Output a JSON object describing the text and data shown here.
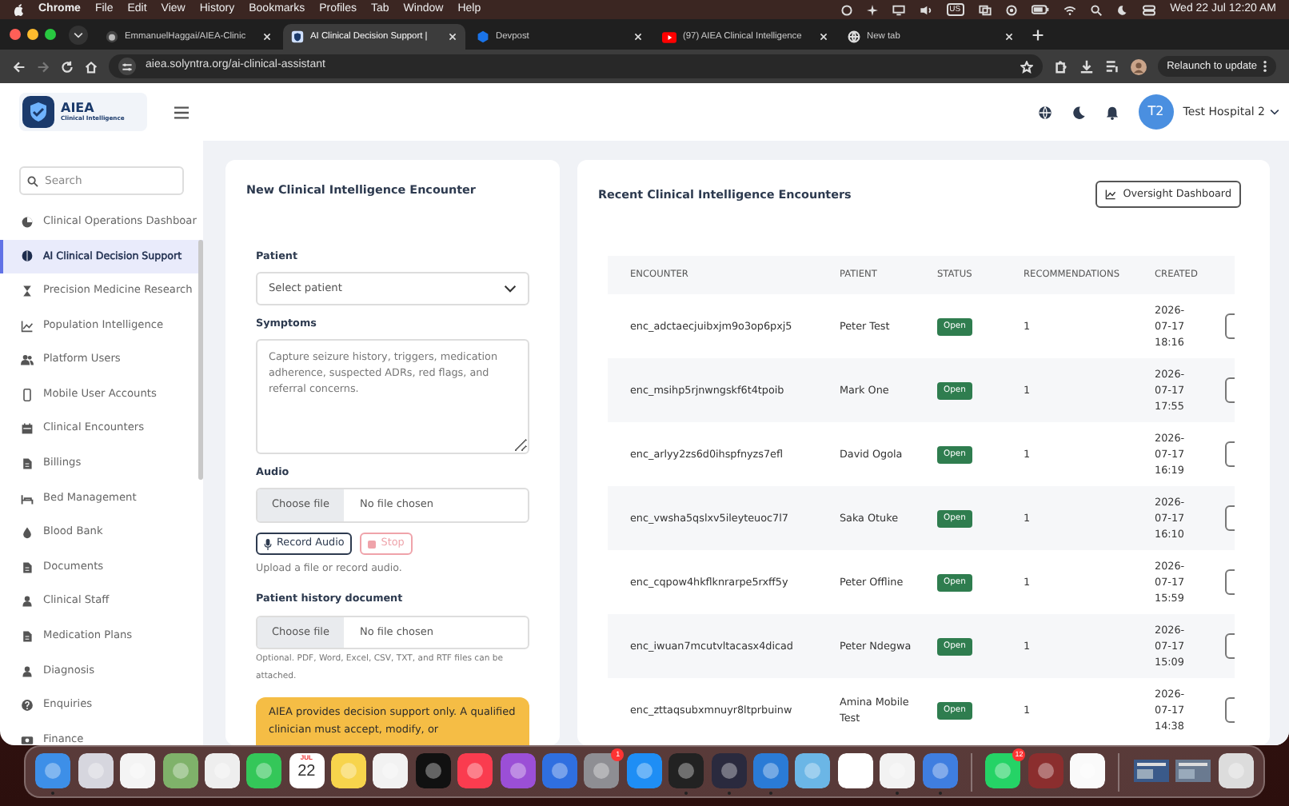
{
  "menubar": {
    "app": "Chrome",
    "menus": [
      "File",
      "Edit",
      "View",
      "History",
      "Bookmarks",
      "Profiles",
      "Tab",
      "Window",
      "Help"
    ],
    "input_source": "US",
    "clock": "Wed 22 Jul  12:20 AM"
  },
  "browser": {
    "tabs": [
      {
        "title": "EmmanuelHaggai/AIEA-Clinic",
        "kind": "github",
        "selected": false
      },
      {
        "title": "AI Clinical Decision Support |",
        "kind": "app",
        "selected": true
      },
      {
        "title": "Devpost",
        "kind": "devpost",
        "selected": false
      },
      {
        "title": "(97) AIEA Clinical Intelligence",
        "kind": "video",
        "selected": false
      },
      {
        "title": "New tab",
        "kind": "chrome",
        "selected": false
      }
    ],
    "url": "aiea.solyntra.org/ai-clinical-assistant",
    "forward_disabled": true,
    "update_button": "Relaunch to update"
  },
  "app": {
    "brand": "AIEA",
    "brand_sub": "Clinical Intelligence",
    "avatar": "T2",
    "hospital": "Test Hospital 2"
  },
  "sidebar": {
    "search_placeholder": "Search",
    "items": [
      {
        "label": "Clinical Operations Dashboar",
        "kind": "pie",
        "selected": false
      },
      {
        "label": "AI Clinical Decision Support",
        "kind": "dot",
        "selected": true
      },
      {
        "label": "Precision Medicine Research",
        "kind": "hourglass",
        "selected": false
      },
      {
        "label": "Population Intelligence",
        "kind": "linechart",
        "selected": false
      },
      {
        "label": "Platform Users",
        "kind": "users",
        "selected": false
      },
      {
        "label": "Mobile User Accounts",
        "kind": "phone",
        "selected": false
      },
      {
        "label": "Clinical Encounters",
        "kind": "calendar",
        "selected": false
      },
      {
        "label": "Billings",
        "kind": "document",
        "selected": false
      },
      {
        "label": "Bed Management",
        "kind": "bed",
        "selected": false
      },
      {
        "label": "Blood Bank",
        "kind": "drop",
        "selected": false
      },
      {
        "label": "Documents",
        "kind": "document",
        "selected": false
      },
      {
        "label": "Clinical Staff",
        "kind": "person",
        "selected": false
      },
      {
        "label": "Medication Plans",
        "kind": "document",
        "selected": false
      },
      {
        "label": "Diagnosis",
        "kind": "person",
        "selected": false
      },
      {
        "label": "Enquiries",
        "kind": "question",
        "selected": false
      },
      {
        "label": "Finance",
        "kind": "money",
        "selected": false
      }
    ]
  },
  "form": {
    "title": "New Clinical Intelligence Encounter",
    "patient_label": "Patient",
    "patient_placeholder": "Select patient",
    "symptoms_label": "Symptoms",
    "symptoms_placeholder": "Capture seizure history, triggers, medication adherence, suspected ADRs, red flags, and referral concerns.",
    "audio_label": "Audio",
    "audio_choose": "Choose file",
    "audio_status": "No file chosen",
    "record_button": "Record Audio",
    "stop_button": "Stop",
    "stop_disabled": true,
    "audio_hint": "Upload a file or record audio.",
    "history_label": "Patient history document",
    "history_choose": "Choose file",
    "history_status": "No file chosen",
    "history_hint": "Optional. PDF, Word, Excel, CSV, TXT, and RTF files can be attached.",
    "notice": "AIEA provides decision support only. A qualified clinician must accept, modify, or"
  },
  "encounters": {
    "title": "Recent Clinical Intelligence Encounters",
    "dashboard_button": "Oversight Dashboard",
    "columns": [
      "ENCOUNTER",
      "PATIENT",
      "STATUS",
      "RECOMMENDATIONS",
      "CREATED"
    ],
    "rows": [
      {
        "encounter": "enc_adctaecjuibxjm9o3op6pxj5",
        "patient": "Peter Test",
        "status": "Open",
        "recommendations": "1",
        "created": "2026-07-17 18:16"
      },
      {
        "encounter": "enc_msihp5rjnwngskf6t4tpoib",
        "patient": "Mark One",
        "status": "Open",
        "recommendations": "1",
        "created": "2026-07-17 17:55"
      },
      {
        "encounter": "enc_arlyy2zs6d0ihspfnyzs7efl",
        "patient": "David Ogola",
        "status": "Open",
        "recommendations": "1",
        "created": "2026-07-17 16:19"
      },
      {
        "encounter": "enc_vwsha5qslxv5ileyteuoc7l7",
        "patient": "Saka Otuke",
        "status": "Open",
        "recommendations": "1",
        "created": "2026-07-17 16:10"
      },
      {
        "encounter": "enc_cqpow4hkflknrarpe5rxff5y",
        "patient": "Peter Offline",
        "status": "Open",
        "recommendations": "1",
        "created": "2026-07-17 15:59"
      },
      {
        "encounter": "enc_iwuan7mcutvltacasx4dicad",
        "patient": "Peter Ndegwa",
        "status": "Open",
        "recommendations": "1",
        "created": "2026-07-17 15:09"
      },
      {
        "encounter": "enc_zttaqsubxmnuyr8ltprbuinw",
        "patient": "Amina Mobile Test",
        "status": "Open",
        "recommendations": "1",
        "created": "2026-07-17 14:38"
      }
    ]
  },
  "dock": [
    {
      "kind": "app",
      "color": "#3d8fe8",
      "running": true
    },
    {
      "kind": "app",
      "color": "#d6d6de",
      "running": false
    },
    {
      "kind": "app",
      "color": "#f4f4f4",
      "running": false
    },
    {
      "kind": "app",
      "color": "#7fb26a",
      "running": false
    },
    {
      "kind": "app",
      "color": "#eeeeee",
      "running": false
    },
    {
      "kind": "app",
      "color": "#34c759",
      "running": false
    },
    {
      "kind": "calendar",
      "month": "JUL",
      "day": "22",
      "running": false
    },
    {
      "kind": "app",
      "color": "#f7d44c",
      "running": false
    },
    {
      "kind": "app",
      "color": "#f2f2f2",
      "running": false
    },
    {
      "kind": "app",
      "color": "#111111",
      "running": false
    },
    {
      "kind": "app",
      "color": "#fa3c4f",
      "running": false
    },
    {
      "kind": "app",
      "color": "#9b4fd6",
      "running": false
    },
    {
      "kind": "app",
      "color": "#2f6fe0",
      "running": false
    },
    {
      "kind": "app",
      "color": "#8e8e93",
      "running": false,
      "badge": "1"
    },
    {
      "kind": "app",
      "color": "#1e8ef5",
      "running": false
    },
    {
      "kind": "app",
      "color": "#222222",
      "running": true
    },
    {
      "kind": "app",
      "color": "#2a2a3e",
      "running": true
    },
    {
      "kind": "app",
      "color": "#2a7bd6",
      "running": true
    },
    {
      "kind": "app",
      "color": "#6bb6e6",
      "running": false
    },
    {
      "kind": "app",
      "color": "#ffffff",
      "running": false
    },
    {
      "kind": "app",
      "color": "#f2f2f2",
      "running": true
    },
    {
      "kind": "app",
      "color": "#3f7ee0",
      "running": true
    },
    {
      "kind": "separator"
    },
    {
      "kind": "app",
      "color": "#25d366",
      "running": false,
      "badge": "12"
    },
    {
      "kind": "app",
      "color": "#8b2e2e",
      "running": false
    },
    {
      "kind": "app",
      "color": "#fafafa",
      "running": false
    },
    {
      "kind": "separator"
    },
    {
      "kind": "window",
      "color": "#3a5a8a",
      "running": false
    },
    {
      "kind": "window",
      "color": "#6a7a90",
      "running": false
    },
    {
      "kind": "app",
      "color": "#dcdcdc",
      "running": false
    }
  ]
}
